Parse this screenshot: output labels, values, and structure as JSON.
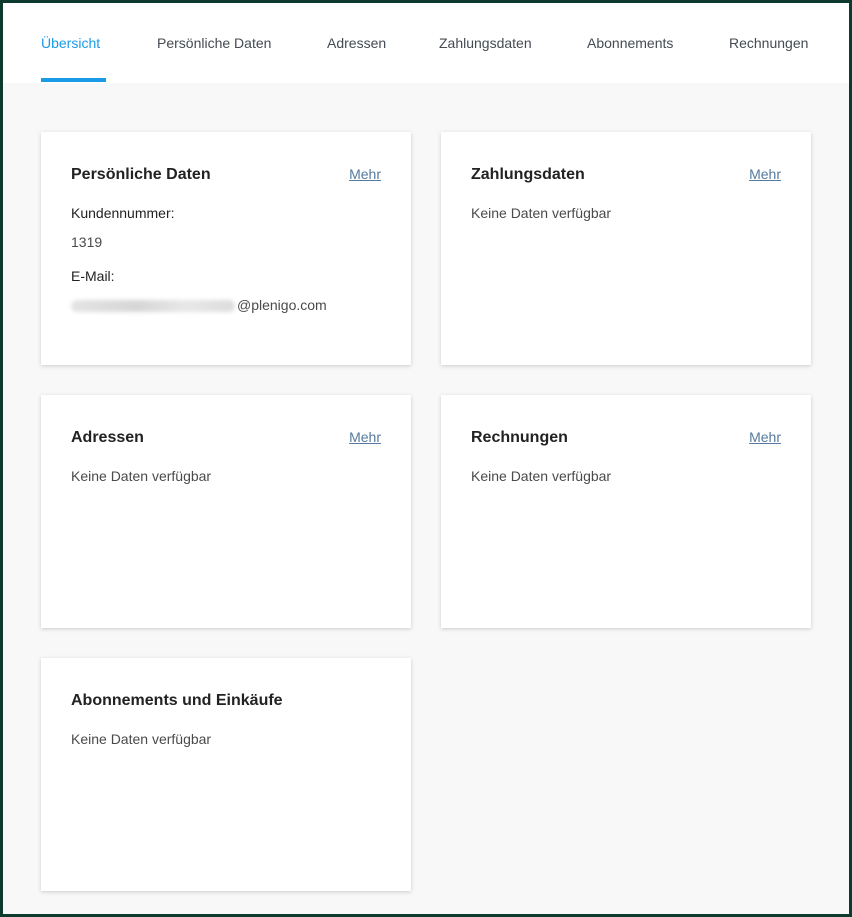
{
  "tabs": [
    {
      "label": "Übersicht"
    },
    {
      "label": "Persönliche Daten"
    },
    {
      "label": "Adressen"
    },
    {
      "label": "Zahlungsdaten"
    },
    {
      "label": "Abonnements"
    },
    {
      "label": "Rechnungen"
    }
  ],
  "active_tab": "Übersicht",
  "accent_color": "#1a9be8",
  "cards": {
    "personal": {
      "title": "Persönliche Daten",
      "link": "Mehr",
      "customer_label": "Kundennummer:",
      "customer_value": "1319",
      "email_label": "E-Mail:",
      "email_domain": "@plenigo.com"
    },
    "payment": {
      "title": "Zahlungsdaten",
      "link": "Mehr",
      "empty": "Keine Daten verfügbar"
    },
    "addresses": {
      "title": "Adressen",
      "link": "Mehr",
      "empty": "Keine Daten verfügbar"
    },
    "invoices": {
      "title": "Rechnungen",
      "link": "Mehr",
      "empty": "Keine Daten verfügbar"
    },
    "subscriptions": {
      "title": "Abonnements und Einkäufe",
      "empty": "Keine Daten verfügbar"
    }
  }
}
